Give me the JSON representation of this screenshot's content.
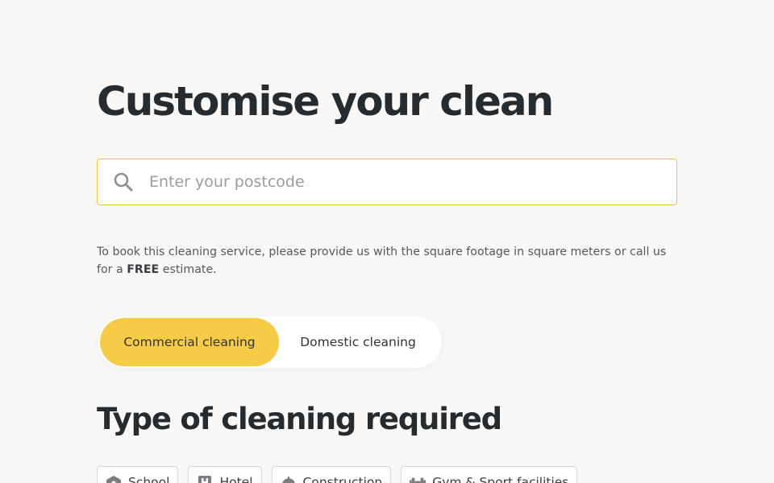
{
  "title": "Customise your clean",
  "search": {
    "placeholder": "Enter your postcode",
    "value": ""
  },
  "description": {
    "text_before": "To book this cleaning service, please provide us with the square footage in square meters or call us for a ",
    "bold": "FREE",
    "text_after": " estimate."
  },
  "service_toggle": {
    "options": [
      {
        "label": "Commercial cleaning",
        "active": true
      },
      {
        "label": "Domestic cleaning",
        "active": false
      }
    ]
  },
  "section": {
    "title": "Type of cleaning required"
  },
  "cleaning_types": [
    {
      "label": "School",
      "icon": "school-icon"
    },
    {
      "label": "Hotel",
      "icon": "hotel-icon"
    },
    {
      "label": "Construction",
      "icon": "construction-icon"
    },
    {
      "label": "Gym & Sport facilities",
      "icon": "dumbbell-icon"
    }
  ],
  "colors": {
    "accent": "#f6cb45",
    "input_border": "#f1c232",
    "background": "#f9f8f6",
    "heading": "#262b2f"
  }
}
